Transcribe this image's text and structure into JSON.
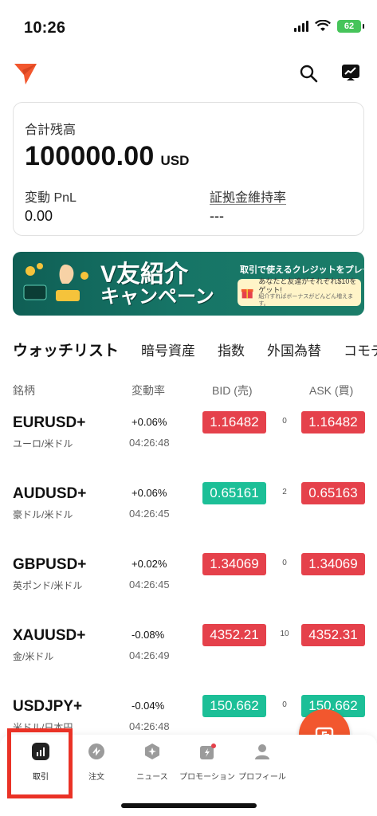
{
  "status": {
    "time": "10:26",
    "battery": "62"
  },
  "balance": {
    "label": "合計残高",
    "amount": "100000.00",
    "currency": "USD",
    "pnl_label": "変動 PnL",
    "pnl_value": "0.00",
    "margin_label": "証拠金維持率",
    "margin_value": "---"
  },
  "banner": {
    "main_line1": "V友紹介",
    "main_line2": "キャンペーン",
    "sub": "取引で使えるクレジットをプレゼント",
    "pill_line": "あなたと友達がそれぞれ$10をゲット!",
    "pill_small": "紹介すればボーナスがどんどん増えます。"
  },
  "tabs": [
    "ウォッチリスト",
    "暗号資産",
    "指数",
    "外国為替",
    "コモディ"
  ],
  "columns": {
    "name": "銘柄",
    "change": "変動率",
    "bid": "BID (売)",
    "ask": "ASK (買)"
  },
  "rows": [
    {
      "symbol": "EURUSD+",
      "name": "ユーロ/米ドル",
      "change": "+0.06%",
      "time": "04:26:48",
      "bid": "1.16482",
      "spread": "0",
      "ask": "1.16482",
      "bid_color": "red",
      "ask_color": "red"
    },
    {
      "symbol": "AUDUSD+",
      "name": "豪ドル/米ドル",
      "change": "+0.06%",
      "time": "04:26:45",
      "bid": "0.65161",
      "spread": "2",
      "ask": "0.65163",
      "bid_color": "green",
      "ask_color": "red"
    },
    {
      "symbol": "GBPUSD+",
      "name": "英ポンド/米ドル",
      "change": "+0.02%",
      "time": "04:26:45",
      "bid": "1.34069",
      "spread": "0",
      "ask": "1.34069",
      "bid_color": "red",
      "ask_color": "red"
    },
    {
      "symbol": "XAUUSD+",
      "name": "金/米ドル",
      "change": "-0.08%",
      "time": "04:26:49",
      "bid": "4352.21",
      "spread": "10",
      "ask": "4352.31",
      "bid_color": "red",
      "ask_color": "red"
    },
    {
      "symbol": "USDJPY+",
      "name": "米ドル/日本円",
      "change": "-0.04%",
      "time": "04:26:48",
      "bid": "150.662",
      "spread": "0",
      "ask": "150.662",
      "bid_color": "green",
      "ask_color": "green"
    }
  ],
  "nav": [
    {
      "label": "取引",
      "icon": "bar-chart-icon"
    },
    {
      "label": "注文",
      "icon": "order-icon"
    },
    {
      "label": "ニュース",
      "icon": "news-icon"
    },
    {
      "label": "プロモーション",
      "icon": "promotion-icon"
    },
    {
      "label": "プロフィール",
      "icon": "profile-icon"
    }
  ],
  "colors": {
    "accent": "#f2572e",
    "up": "#1cbf97",
    "down": "#e5414b",
    "highlight": "#ea3226"
  }
}
